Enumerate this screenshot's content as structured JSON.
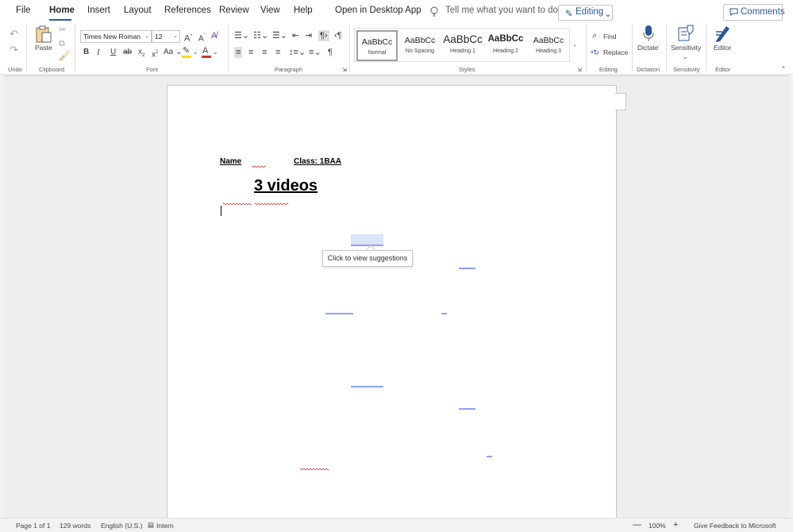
{
  "menu": {
    "items": [
      "File",
      "Home",
      "Insert",
      "Layout",
      "References",
      "Review",
      "View",
      "Help",
      "Open in Desktop App"
    ],
    "active": "Home",
    "tell_me_placeholder": "Tell me what you want to do",
    "editing_label": "Editing",
    "comments_label": "Comments"
  },
  "ribbon": {
    "groups": {
      "undo": "Undo",
      "clipboard": "Clipboard",
      "font": "Font",
      "paragraph": "Paragraph",
      "styles": "Styles",
      "editing": "Editing",
      "dictation": "Dictation",
      "sensitivity": "Sensitivity",
      "editor": "Editor"
    },
    "paste_label": "Paste",
    "font_name": "Times New Roman",
    "font_size": "12",
    "font_case": "Aa",
    "styles": [
      {
        "sample": "AaBbCc",
        "name": "Normal"
      },
      {
        "sample": "AaBbCc",
        "name": "No Spacing"
      },
      {
        "sample": "AaBbCc",
        "name": "Heading 1"
      },
      {
        "sample": "AaBbCc",
        "name": "Heading 2"
      },
      {
        "sample": "AaBbCc",
        "name": "Heading 3"
      }
    ],
    "find_label": "Find",
    "replace_label": "Replace",
    "dictate_label": "Dictate",
    "sensitivity_label": "Sensitivity",
    "editor_label": "Editor"
  },
  "document": {
    "name_label": "Name",
    "class_label": "Class: 1BAA",
    "title": "3 videos",
    "tooltip": "Click to view suggestions"
  },
  "status": {
    "page": "Page 1 of 1",
    "words": "129 words",
    "language": "English (U.S.)",
    "mode": "Intern",
    "zoom": "100%",
    "feedback": "Give Feedback to Microsoft"
  },
  "colors": {
    "accent": "#2b579a",
    "highlight": "#ffd900",
    "font_color": "#d13438",
    "suggestion": "#8c9ff0"
  }
}
